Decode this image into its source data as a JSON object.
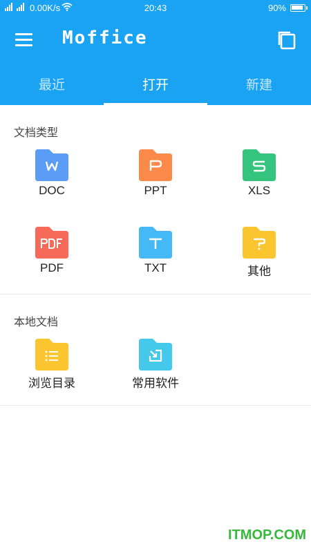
{
  "status_bar": {
    "speed": "0.00K/s",
    "time": "20:43",
    "battery": "90%"
  },
  "header": {
    "title": "Moffice",
    "menu_icon": "hamburger-menu-icon",
    "copy_icon": "copy-icon"
  },
  "tabs": [
    {
      "label": "最近"
    },
    {
      "label": "打开",
      "active": true
    },
    {
      "label": "新建"
    }
  ],
  "file_types": {
    "title": "文档类型",
    "items": [
      {
        "label": "DOC",
        "glyph": "W",
        "color": "#5a9cf6"
      },
      {
        "label": "PPT",
        "glyph": "P",
        "color": "#fb8a4a"
      },
      {
        "label": "XLS",
        "glyph": "S",
        "color": "#35c47e"
      },
      {
        "label": "PDF",
        "glyph": "PDF",
        "color": "#f76a5a"
      },
      {
        "label": "TXT",
        "glyph": "T",
        "color": "#45b9f5"
      },
      {
        "label": "其他",
        "glyph": "?",
        "color": "#fbc530"
      }
    ]
  },
  "local_docs": {
    "title": "本地文档",
    "items": [
      {
        "label": "浏览目录",
        "icon": "list-icon",
        "color": "#fbc530"
      },
      {
        "label": "常用软件",
        "icon": "app-shortcut-icon",
        "color": "#45c9ea"
      }
    ]
  },
  "watermark": "ITMOP.COM"
}
